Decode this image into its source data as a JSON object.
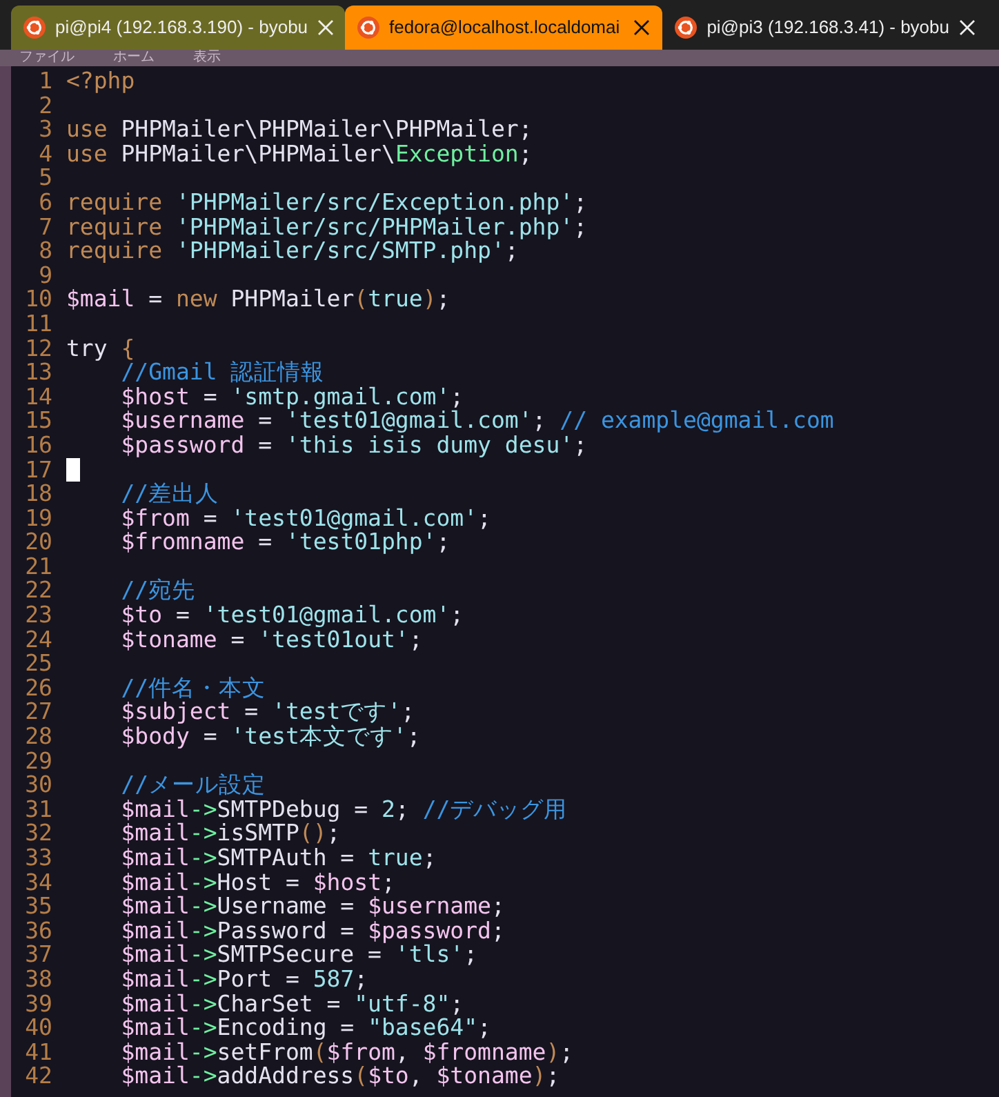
{
  "tabs": [
    {
      "title": "pi@pi4 (192.168.3.190) - byobu",
      "selected": false,
      "color": "#6b6a25"
    },
    {
      "title": "fedora@localhost.localdomai",
      "selected": true,
      "color": "#ff8c00"
    },
    {
      "title": "pi@pi3 (192.168.3.41) - byobu",
      "selected": false,
      "color": "#202020"
    }
  ],
  "background_menu": [
    "ファイル",
    "ホーム",
    "表示"
  ],
  "editor": {
    "lines": [
      {
        "number": "1",
        "tokens": [
          {
            "kind": "keyword",
            "text": "<?php"
          }
        ]
      },
      {
        "number": "2"
      },
      {
        "number": "3",
        "tokens": [
          {
            "kind": "keyword",
            "text": "use"
          },
          {
            "kind": "plain",
            "text": " PHPMailer\\PHPMailer\\PHPMailer;"
          }
        ]
      },
      {
        "number": "4",
        "tokens": [
          {
            "kind": "keyword",
            "text": "use"
          },
          {
            "kind": "plain",
            "text": " PHPMailer\\PHPMailer\\"
          },
          {
            "kind": "class",
            "text": "Exception"
          },
          {
            "kind": "plain",
            "text": ";"
          }
        ]
      },
      {
        "number": "5"
      },
      {
        "number": "6",
        "tokens": [
          {
            "kind": "keyword",
            "text": "require "
          },
          {
            "kind": "string",
            "text": "'PHPMailer/src/Exception.php'"
          },
          {
            "kind": "plain",
            "text": ";"
          }
        ]
      },
      {
        "number": "7",
        "tokens": [
          {
            "kind": "keyword",
            "text": "require "
          },
          {
            "kind": "string",
            "text": "'PHPMailer/src/PHPMailer.php'"
          },
          {
            "kind": "plain",
            "text": ";"
          }
        ]
      },
      {
        "number": "8",
        "tokens": [
          {
            "kind": "keyword",
            "text": "require "
          },
          {
            "kind": "string",
            "text": "'PHPMailer/src/SMTP.php'"
          },
          {
            "kind": "plain",
            "text": ";"
          }
        ]
      },
      {
        "number": "9"
      },
      {
        "number": "10",
        "tokens": [
          {
            "kind": "variable",
            "text": "$mail"
          },
          {
            "kind": "plain",
            "text": " = "
          },
          {
            "kind": "keyword",
            "text": "new"
          },
          {
            "kind": "plain",
            "text": " PHPMailer"
          },
          {
            "kind": "keyword",
            "text": "("
          },
          {
            "kind": "string",
            "text": "true"
          },
          {
            "kind": "keyword",
            "text": ")"
          },
          {
            "kind": "plain",
            "text": ";"
          }
        ]
      },
      {
        "number": "11"
      },
      {
        "number": "12",
        "tokens": [
          {
            "kind": "plain",
            "text": "try "
          },
          {
            "kind": "keyword",
            "text": "{"
          }
        ]
      },
      {
        "number": "13",
        "tokens": [
          {
            "kind": "comment",
            "text": "    //Gmail 認証情報"
          }
        ]
      },
      {
        "number": "14",
        "tokens": [
          {
            "kind": "variable",
            "text": "    $host"
          },
          {
            "kind": "plain",
            "text": " = "
          },
          {
            "kind": "string",
            "text": "'smtp.gmail.com'"
          },
          {
            "kind": "plain",
            "text": ";"
          }
        ]
      },
      {
        "number": "15",
        "tokens": [
          {
            "kind": "variable",
            "text": "    $username"
          },
          {
            "kind": "plain",
            "text": " = "
          },
          {
            "kind": "string",
            "text": "'test01@gmail.com'"
          },
          {
            "kind": "plain",
            "text": "; "
          },
          {
            "kind": "comment",
            "text": "// example@gmail.com"
          }
        ]
      },
      {
        "number": "16",
        "tokens": [
          {
            "kind": "variable",
            "text": "    $password"
          },
          {
            "kind": "plain",
            "text": " = "
          },
          {
            "kind": "string",
            "text": "'this isis dumy desu'"
          },
          {
            "kind": "plain",
            "text": ";"
          }
        ]
      },
      {
        "number": "17",
        "cursor": true
      },
      {
        "number": "18",
        "tokens": [
          {
            "kind": "comment",
            "text": "    //差出人"
          }
        ]
      },
      {
        "number": "19",
        "tokens": [
          {
            "kind": "variable",
            "text": "    $from"
          },
          {
            "kind": "plain",
            "text": " = "
          },
          {
            "kind": "string",
            "text": "'test01@gmail.com'"
          },
          {
            "kind": "plain",
            "text": ";"
          }
        ]
      },
      {
        "number": "20",
        "tokens": [
          {
            "kind": "variable",
            "text": "    $fromname"
          },
          {
            "kind": "plain",
            "text": " = "
          },
          {
            "kind": "string",
            "text": "'test01php'"
          },
          {
            "kind": "plain",
            "text": ";"
          }
        ]
      },
      {
        "number": "21"
      },
      {
        "number": "22",
        "tokens": [
          {
            "kind": "comment",
            "text": "    //宛先"
          }
        ]
      },
      {
        "number": "23",
        "tokens": [
          {
            "kind": "variable",
            "text": "    $to"
          },
          {
            "kind": "plain",
            "text": " = "
          },
          {
            "kind": "string",
            "text": "'test01@gmail.com'"
          },
          {
            "kind": "plain",
            "text": ";"
          }
        ]
      },
      {
        "number": "24",
        "tokens": [
          {
            "kind": "variable",
            "text": "    $toname"
          },
          {
            "kind": "plain",
            "text": " = "
          },
          {
            "kind": "string",
            "text": "'test01out'"
          },
          {
            "kind": "plain",
            "text": ";"
          }
        ]
      },
      {
        "number": "25"
      },
      {
        "number": "26",
        "tokens": [
          {
            "kind": "comment",
            "text": "    //件名・本文"
          }
        ]
      },
      {
        "number": "27",
        "tokens": [
          {
            "kind": "variable",
            "text": "    $subject"
          },
          {
            "kind": "plain",
            "text": " = "
          },
          {
            "kind": "string",
            "text": "'testです'"
          },
          {
            "kind": "plain",
            "text": ";"
          }
        ]
      },
      {
        "number": "28",
        "tokens": [
          {
            "kind": "variable",
            "text": "    $body"
          },
          {
            "kind": "plain",
            "text": " = "
          },
          {
            "kind": "string",
            "text": "'test本文です'"
          },
          {
            "kind": "plain",
            "text": ";"
          }
        ]
      },
      {
        "number": "29"
      },
      {
        "number": "30",
        "tokens": [
          {
            "kind": "comment",
            "text": "    //メール設定"
          }
        ]
      },
      {
        "number": "31",
        "tokens": [
          {
            "kind": "variable",
            "text": "    $mail"
          },
          {
            "kind": "class",
            "text": "->"
          },
          {
            "kind": "plain",
            "text": "SMTPDebug = "
          },
          {
            "kind": "string",
            "text": "2"
          },
          {
            "kind": "plain",
            "text": "; "
          },
          {
            "kind": "comment",
            "text": "//デバッグ用"
          }
        ]
      },
      {
        "number": "32",
        "tokens": [
          {
            "kind": "variable",
            "text": "    $mail"
          },
          {
            "kind": "class",
            "text": "->"
          },
          {
            "kind": "plain",
            "text": "isSMTP"
          },
          {
            "kind": "keyword",
            "text": "()"
          },
          {
            "kind": "plain",
            "text": ";"
          }
        ]
      },
      {
        "number": "33",
        "tokens": [
          {
            "kind": "variable",
            "text": "    $mail"
          },
          {
            "kind": "class",
            "text": "->"
          },
          {
            "kind": "plain",
            "text": "SMTPAuth = "
          },
          {
            "kind": "string",
            "text": "true"
          },
          {
            "kind": "plain",
            "text": ";"
          }
        ]
      },
      {
        "number": "34",
        "tokens": [
          {
            "kind": "variable",
            "text": "    $mail"
          },
          {
            "kind": "class",
            "text": "->"
          },
          {
            "kind": "plain",
            "text": "Host = "
          },
          {
            "kind": "variable",
            "text": "$host"
          },
          {
            "kind": "plain",
            "text": ";"
          }
        ]
      },
      {
        "number": "35",
        "tokens": [
          {
            "kind": "variable",
            "text": "    $mail"
          },
          {
            "kind": "class",
            "text": "->"
          },
          {
            "kind": "plain",
            "text": "Username = "
          },
          {
            "kind": "variable",
            "text": "$username"
          },
          {
            "kind": "plain",
            "text": ";"
          }
        ]
      },
      {
        "number": "36",
        "tokens": [
          {
            "kind": "variable",
            "text": "    $mail"
          },
          {
            "kind": "class",
            "text": "->"
          },
          {
            "kind": "plain",
            "text": "Password = "
          },
          {
            "kind": "variable",
            "text": "$password"
          },
          {
            "kind": "plain",
            "text": ";"
          }
        ]
      },
      {
        "number": "37",
        "tokens": [
          {
            "kind": "variable",
            "text": "    $mail"
          },
          {
            "kind": "class",
            "text": "->"
          },
          {
            "kind": "plain",
            "text": "SMTPSecure = "
          },
          {
            "kind": "string",
            "text": "'tls'"
          },
          {
            "kind": "plain",
            "text": ";"
          }
        ]
      },
      {
        "number": "38",
        "tokens": [
          {
            "kind": "variable",
            "text": "    $mail"
          },
          {
            "kind": "class",
            "text": "->"
          },
          {
            "kind": "plain",
            "text": "Port = "
          },
          {
            "kind": "string",
            "text": "587"
          },
          {
            "kind": "plain",
            "text": ";"
          }
        ]
      },
      {
        "number": "39",
        "tokens": [
          {
            "kind": "variable",
            "text": "    $mail"
          },
          {
            "kind": "class",
            "text": "->"
          },
          {
            "kind": "plain",
            "text": "CharSet = "
          },
          {
            "kind": "string",
            "text": "\"utf-8\""
          },
          {
            "kind": "plain",
            "text": ";"
          }
        ]
      },
      {
        "number": "40",
        "tokens": [
          {
            "kind": "variable",
            "text": "    $mail"
          },
          {
            "kind": "class",
            "text": "->"
          },
          {
            "kind": "plain",
            "text": "Encoding = "
          },
          {
            "kind": "string",
            "text": "\"base64\""
          },
          {
            "kind": "plain",
            "text": ";"
          }
        ]
      },
      {
        "number": "41",
        "tokens": [
          {
            "kind": "variable",
            "text": "    $mail"
          },
          {
            "kind": "class",
            "text": "->"
          },
          {
            "kind": "plain",
            "text": "setFrom"
          },
          {
            "kind": "keyword",
            "text": "("
          },
          {
            "kind": "variable",
            "text": "$from"
          },
          {
            "kind": "plain",
            "text": ", "
          },
          {
            "kind": "variable",
            "text": "$fromname"
          },
          {
            "kind": "keyword",
            "text": ")"
          },
          {
            "kind": "plain",
            "text": ";"
          }
        ]
      },
      {
        "number": "42",
        "tokens": [
          {
            "kind": "variable",
            "text": "    $mail"
          },
          {
            "kind": "class",
            "text": "->"
          },
          {
            "kind": "plain",
            "text": "addAddress"
          },
          {
            "kind": "keyword",
            "text": "("
          },
          {
            "kind": "variable",
            "text": "$to"
          },
          {
            "kind": "plain",
            "text": ", "
          },
          {
            "kind": "variable",
            "text": "$toname"
          },
          {
            "kind": "keyword",
            "text": ")"
          },
          {
            "kind": "plain",
            "text": ";"
          }
        ]
      }
    ]
  }
}
